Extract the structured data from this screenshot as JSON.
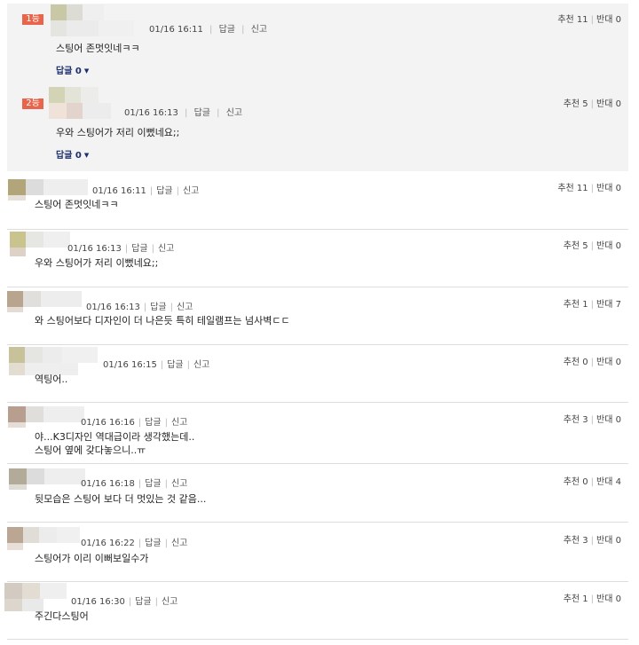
{
  "labels": {
    "reply": "답글",
    "report": "신고",
    "up": "추천",
    "down": "반대",
    "reply_count_label": "답글 0"
  },
  "best_comments": [
    {
      "rank": "1등",
      "time": "01/16 16:11",
      "text": "스팅어 존멋잇네ㅋㅋ",
      "up": "11",
      "down": "0"
    },
    {
      "rank": "2등",
      "time": "01/16 16:13",
      "text": "우와 스팅어가 저리 이뻤네요;;",
      "up": "5",
      "down": "0"
    }
  ],
  "comments": [
    {
      "time": "01/16 16:11",
      "text": "스팅어 존멋잇네ㅋㅋ",
      "up": "11",
      "down": "0"
    },
    {
      "time": "01/16 16:13",
      "text": "우와 스팅어가 저리 이뻤네요;;",
      "up": "5",
      "down": "0"
    },
    {
      "time": "01/16 16:13",
      "text": "와 스팅어보다 디자인이 더 나은듯 특히 테일램프는 넘사벽ㄷㄷ",
      "up": "1",
      "down": "7"
    },
    {
      "time": "01/16 16:15",
      "text": "역팅어..",
      "up": "0",
      "down": "0"
    },
    {
      "time": "01/16 16:16",
      "text": "야...K3디자인 역대급이라 생각했는데..\n스팅어 옆에 갖다놓으니..ㅠ",
      "up": "3",
      "down": "0"
    },
    {
      "time": "01/16 16:18",
      "text": "뒷모습은 스팅어 보다 더 멋있는 것 같음...",
      "up": "0",
      "down": "4"
    },
    {
      "time": "01/16 16:22",
      "text": "스팅어가 이리 이뻐보일수가",
      "up": "3",
      "down": "0"
    },
    {
      "time": "01/16 16:30",
      "text": "주긴다스팅어",
      "up": "1",
      "down": "0"
    }
  ],
  "colors": {
    "rank_badge": "#e8644a",
    "best_bg": "#f3f3f3",
    "reply_link": "#1b2e6e"
  }
}
